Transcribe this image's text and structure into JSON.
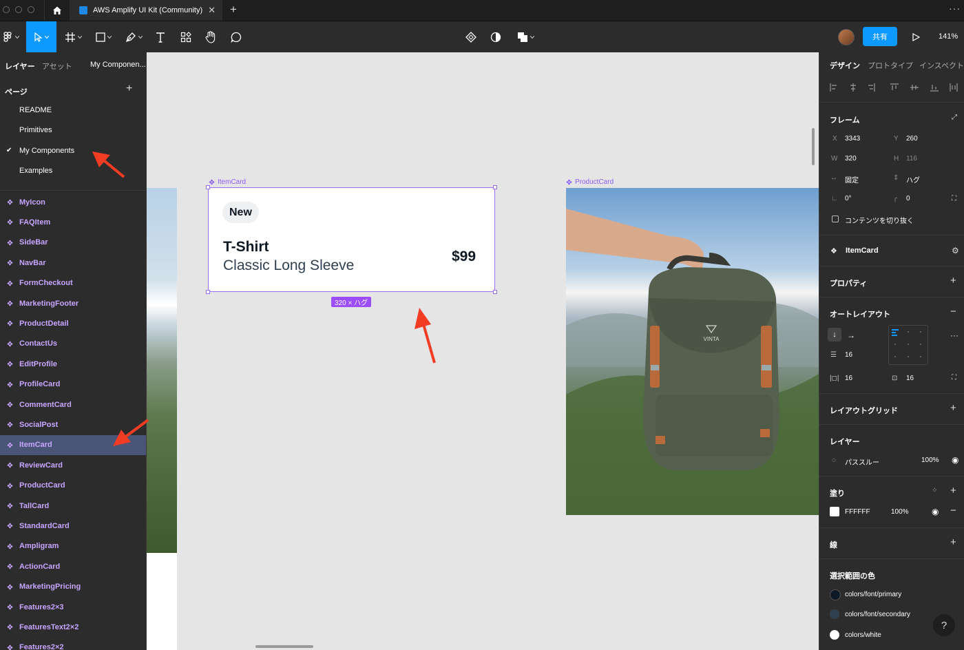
{
  "window": {
    "tab_title": "AWS Amplify UI Kit (Community)",
    "new_tab": "+",
    "more": "···"
  },
  "toolbar": {
    "share_label": "共有",
    "zoom": "141%"
  },
  "left_panel": {
    "tabs": [
      "レイヤー",
      "アセット",
      "My Componen..."
    ],
    "pages_title": "ページ",
    "pages": [
      {
        "label": "README",
        "checked": false
      },
      {
        "label": "Primitives",
        "checked": false
      },
      {
        "label": "My Components",
        "checked": true
      },
      {
        "label": "Examples",
        "checked": false
      }
    ],
    "layers": [
      "MyIcon",
      "FAQItem",
      "SideBar",
      "NavBar",
      "FormCheckout",
      "MarketingFooter",
      "ProductDetail",
      "ContactUs",
      "EditProfile",
      "ProfileCard",
      "CommentCard",
      "SocialPost",
      "ItemCard",
      "ReviewCard",
      "ProductCard",
      "TallCard",
      "StandardCard",
      "Ampligram",
      "ActionCard",
      "MarketingPricing",
      "Features2×3",
      "FeaturesText2×2",
      "Features2×2"
    ],
    "selected_layer": "ItemCard"
  },
  "canvas": {
    "item_card_label": "ItemCard",
    "product_card_label": "ProductCard",
    "badge": "New",
    "title": "T-Shirt",
    "subtitle": "Classic Long Sleeve",
    "price": "$99",
    "size_chip": "320 × ハグ",
    "backpack_brand": "VINTA"
  },
  "right_panel": {
    "tabs": [
      "デザイン",
      "プロトタイプ",
      "インスペクト"
    ],
    "frame": {
      "title": "フレーム",
      "x_label": "X",
      "x": "3343",
      "y_label": "Y",
      "y": "260",
      "w_label": "W",
      "w": "320",
      "h_label": "H",
      "h": "116",
      "h_constraint": "固定",
      "v_constraint": "ハグ",
      "rotation": "0°",
      "radius": "0",
      "clip_label": "コンテンツを切り抜く"
    },
    "component_name": "ItemCard",
    "properties_title": "プロパティ",
    "auto_layout": {
      "title": "オートレイアウト",
      "gap": "16",
      "pad_h": "16",
      "pad_v": "16"
    },
    "layout_grid_title": "レイアウトグリッド",
    "layer": {
      "title": "レイヤー",
      "blend": "パススルー",
      "opacity": "100%"
    },
    "fill": {
      "title": "塗り",
      "hex": "FFFFFF",
      "opacity": "100%"
    },
    "stroke_title": "線",
    "selection_colors": {
      "title": "選択範囲の色",
      "items": [
        {
          "name": "colors/font/primary",
          "color": "#0d1a26"
        },
        {
          "name": "colors/font/secondary",
          "color": "#304050"
        },
        {
          "name": "colors/white",
          "color": "#ffffff"
        }
      ]
    },
    "help": "?"
  },
  "colors": {
    "accent": "#0d99ff",
    "component_purple": "#9b6cf7",
    "arrow_red": "#f23c24"
  }
}
